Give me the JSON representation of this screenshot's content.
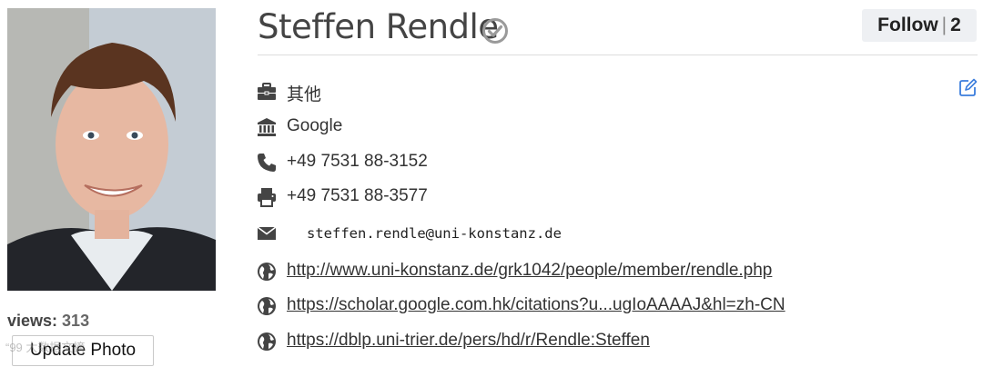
{
  "profile": {
    "name": "Steffen Rendle",
    "views_label": "views:",
    "views_count": "313",
    "update_photo_label": "Update Photo",
    "watermark": "“99 大数据文摘"
  },
  "follow": {
    "label": "Follow",
    "separator": "|",
    "count": "2"
  },
  "details": {
    "position": "其他",
    "organization": "Google",
    "phone": "+49 7531 88-3152",
    "fax": "+49 7531 88-3577",
    "email": "steffen.rendle@uni-konstanz.de",
    "homepage": "http://www.uni-konstanz.de/grk1042/people/member/rendle.php",
    "scholar": "https://scholar.google.com.hk/citations?u...ugIoAAAAJ&hl=zh-CN",
    "dblp": "https://dblp.uni-trier.de/pers/hd/r/Rendle:Steffen"
  },
  "icons": {
    "position": "briefcase-icon",
    "organization": "institution-icon",
    "phone": "phone-icon",
    "fax": "fax-icon",
    "email": "envelope-icon",
    "links": "globe-icon",
    "edit": "edit-icon",
    "verified": "check-circle-icon"
  },
  "colors": {
    "text": "#333333",
    "icon": "#444444",
    "edit_icon": "#3b7ddd",
    "follow_bg": "#eef0f3"
  }
}
